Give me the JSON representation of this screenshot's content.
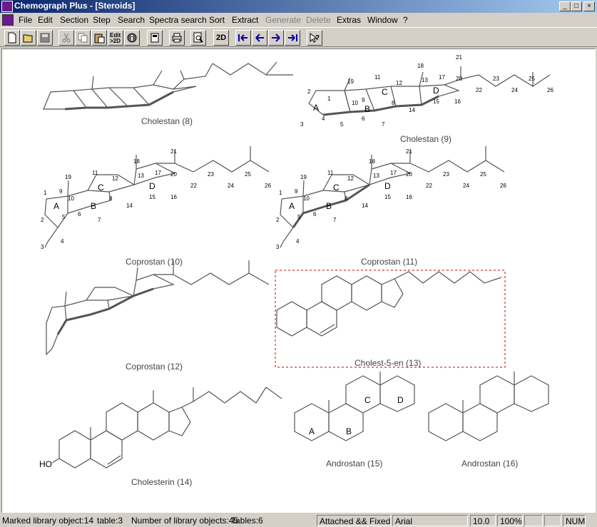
{
  "window": {
    "title": "Chemograph Plus - [Steroids]"
  },
  "menu": [
    "File",
    "Edit",
    "Section",
    "Step",
    "Search",
    "Spectra search",
    "Sort",
    "Extract",
    "Generate",
    "Delete",
    "Extras",
    "Window",
    "?"
  ],
  "menu_disabled": [
    "Generate",
    "Delete"
  ],
  "toolbar": {
    "edit_label": "Edit\n>2D",
    "view2d_label": "2D"
  },
  "molecules": [
    {
      "id": "m8",
      "caption": "Cholestan (8)"
    },
    {
      "id": "m9",
      "caption": "Cholestan (9)"
    },
    {
      "id": "m10",
      "caption": "Coprostan (10)"
    },
    {
      "id": "m11",
      "caption": "Coprostan (11)"
    },
    {
      "id": "m12",
      "caption": "Coprostan (12)"
    },
    {
      "id": "m13",
      "caption": "Cholest-5-en (13)",
      "selected": true
    },
    {
      "id": "m14",
      "caption": "Cholesterin (14)",
      "label": "HO"
    },
    {
      "id": "m15",
      "caption": "Androstan (15)"
    },
    {
      "id": "m16",
      "caption": "Androstan (16)"
    }
  ],
  "ring_labels": [
    "A",
    "B",
    "C",
    "D"
  ],
  "atom_numbers_9": [
    "1",
    "2",
    "3",
    "4",
    "5",
    "6",
    "7",
    "8",
    "9",
    "10",
    "11",
    "12",
    "13",
    "14",
    "15",
    "16",
    "17",
    "18",
    "19",
    "20",
    "21",
    "22",
    "23",
    "24",
    "25",
    "26"
  ],
  "status": {
    "marked": "Marked library object:14",
    "table": "table:3",
    "count": "Number of library objects:45",
    "tables": "Tables:6",
    "mode": "Attached && Fixed",
    "font": "Arial",
    "size": "10.0",
    "zoom": "100%",
    "num": "NUM"
  },
  "colors": {
    "titlebar_start": "#0a246a",
    "titlebar_end": "#a6caf0",
    "selection": "#d00000"
  }
}
